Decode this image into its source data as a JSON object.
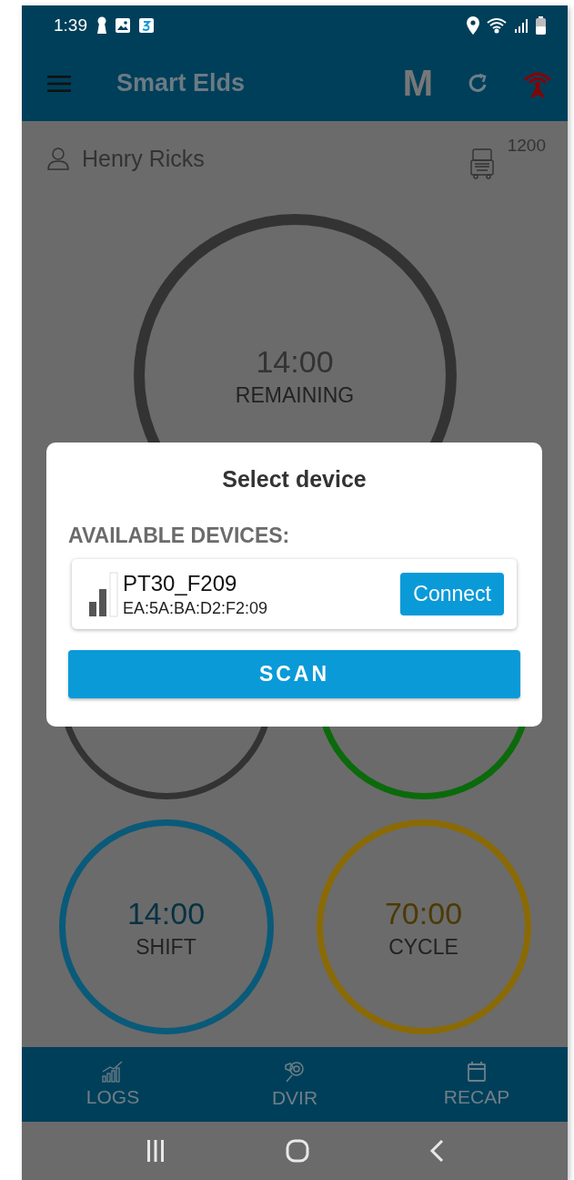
{
  "status_bar": {
    "time": "1:39"
  },
  "app_bar": {
    "title": "Smart Elds",
    "mode_badge": "M"
  },
  "driver": {
    "name": "Henry Ricks",
    "truck_number": "1200"
  },
  "main_gauge": {
    "value": "14:00",
    "label": "REMAINING"
  },
  "gauges": [
    {
      "color": "#333333"
    },
    {
      "color": "#0b6a0b"
    },
    {
      "value": "14:00",
      "label": "SHIFT",
      "color": "#0a5a7a"
    },
    {
      "value": "70:00",
      "label": "CYCLE",
      "color": "#8a6a06"
    }
  ],
  "dialog": {
    "title": "Select device",
    "section_label": "AVAILABLE DEVICES:",
    "devices": [
      {
        "name": "PT30_F209",
        "address": "EA:5A:BA:D2:F2:09",
        "button": "Connect"
      }
    ],
    "scan_button": "SCAN"
  },
  "bottom_nav": [
    {
      "label": "LOGS",
      "kind": "chart"
    },
    {
      "label": "DVIR",
      "kind": "dvir"
    },
    {
      "label": "RECAP",
      "kind": "calendar"
    }
  ]
}
